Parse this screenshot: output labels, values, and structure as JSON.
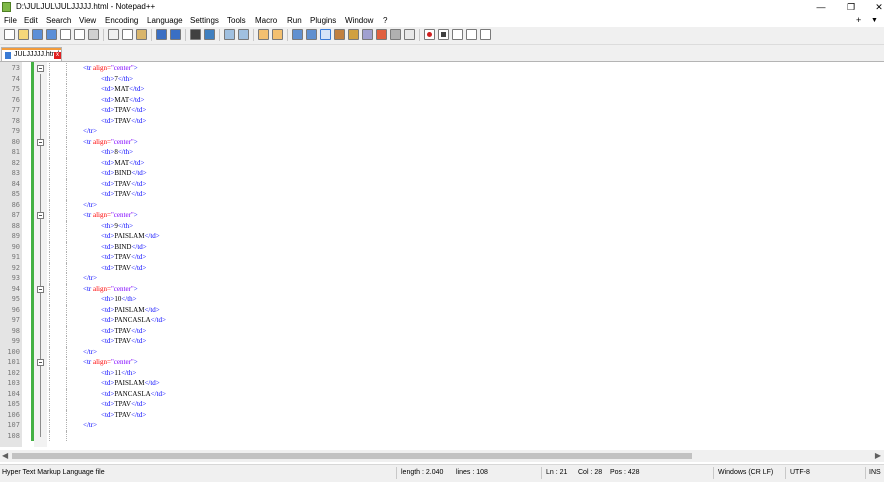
{
  "window": {
    "title": "D:\\JULJUL\\JULJJJJJ.html - Notepad++",
    "minimize_label": "—",
    "maximize_label": "❐",
    "close_label": "✕"
  },
  "menu": {
    "items": [
      "File",
      "Edit",
      "Search",
      "View",
      "Encoding",
      "Language",
      "Settings",
      "Tools",
      "Macro",
      "Run",
      "Plugins",
      "Window",
      "?"
    ],
    "add_label": "+",
    "dropdown_label": "▼"
  },
  "tab": {
    "label": "JULJJJJJ.html",
    "close_label": "x",
    "accent_color": "#f39c3c"
  },
  "editor": {
    "lines": [
      {
        "n": "73",
        "kind": "open"
      },
      {
        "n": "74",
        "kind": "cell",
        "tag": "th",
        "text": "7"
      },
      {
        "n": "75",
        "kind": "cell",
        "tag": "td",
        "text": "MAT"
      },
      {
        "n": "76",
        "kind": "cell",
        "tag": "td",
        "text": "MAT"
      },
      {
        "n": "77",
        "kind": "cell",
        "tag": "td",
        "text": "TPAV"
      },
      {
        "n": "78",
        "kind": "cell",
        "tag": "td",
        "text": "TPAV"
      },
      {
        "n": "79",
        "kind": "close"
      },
      {
        "n": "80",
        "kind": "open"
      },
      {
        "n": "81",
        "kind": "cell",
        "tag": "th",
        "text": "8"
      },
      {
        "n": "82",
        "kind": "cell",
        "tag": "td",
        "text": "MAT"
      },
      {
        "n": "83",
        "kind": "cell",
        "tag": "td",
        "text": "BIND"
      },
      {
        "n": "84",
        "kind": "cell",
        "tag": "td",
        "text": "TPAV"
      },
      {
        "n": "85",
        "kind": "cell",
        "tag": "td",
        "text": "TPAV"
      },
      {
        "n": "86",
        "kind": "close"
      },
      {
        "n": "87",
        "kind": "open"
      },
      {
        "n": "88",
        "kind": "cell",
        "tag": "th",
        "text": "9"
      },
      {
        "n": "89",
        "kind": "cell",
        "tag": "td",
        "text": "PAISLAM"
      },
      {
        "n": "90",
        "kind": "cell",
        "tag": "td",
        "text": "BIND"
      },
      {
        "n": "91",
        "kind": "cell",
        "tag": "td",
        "text": "TPAV"
      },
      {
        "n": "92",
        "kind": "cell",
        "tag": "td",
        "text": "TPAV"
      },
      {
        "n": "93",
        "kind": "close"
      },
      {
        "n": "94",
        "kind": "open"
      },
      {
        "n": "95",
        "kind": "cell",
        "tag": "th",
        "text": "10"
      },
      {
        "n": "96",
        "kind": "cell",
        "tag": "td",
        "text": "PAISLAM"
      },
      {
        "n": "97",
        "kind": "cell",
        "tag": "td",
        "text": "PANCASLA"
      },
      {
        "n": "98",
        "kind": "cell",
        "tag": "td",
        "text": "TPAV"
      },
      {
        "n": "99",
        "kind": "cell",
        "tag": "td",
        "text": "TPAV"
      },
      {
        "n": "100",
        "kind": "close"
      },
      {
        "n": "101",
        "kind": "open"
      },
      {
        "n": "102",
        "kind": "cell",
        "tag": "th",
        "text": "11"
      },
      {
        "n": "103",
        "kind": "cell",
        "tag": "td",
        "text": "PAISLAM"
      },
      {
        "n": "104",
        "kind": "cell",
        "tag": "td",
        "text": "PANCASLA"
      },
      {
        "n": "105",
        "kind": "cell",
        "tag": "td",
        "text": "TPAV"
      },
      {
        "n": "106",
        "kind": "cell",
        "tag": "td",
        "text": "TPAV"
      },
      {
        "n": "107",
        "kind": "close"
      },
      {
        "n": "108",
        "kind": "empty"
      }
    ],
    "tr_open_tag": "<tr",
    "tr_attr": "align=",
    "tr_value": "\"center\"",
    "tr_end": ">",
    "tr_close": "</tr>",
    "colors": {
      "tag": "#0000ff",
      "attr": "#ff0000",
      "value": "#8000ff",
      "text": "#000000",
      "change_bar": "#43b043"
    }
  },
  "status": {
    "file_type": "Hyper Text Markup Language file",
    "length": "length : 2.040",
    "lines": "lines : 108",
    "ln": "Ln : 21",
    "col": "Col : 28",
    "pos": "Pos : 428",
    "eol": "Windows (CR LF)",
    "encoding": "UTF-8",
    "mode": "INS"
  },
  "toolbar": {
    "icons": [
      "new-file-icon",
      "open-file-icon",
      "save-icon",
      "save-all-icon",
      "close-icon",
      "close-all-icon",
      "print-icon",
      "cut-icon",
      "copy-icon",
      "paste-icon",
      "undo-icon",
      "redo-icon",
      "find-icon",
      "replace-icon",
      "zoom-in-icon",
      "zoom-out-icon",
      "sync-vertical-icon",
      "sync-horizontal-icon",
      "word-wrap-icon",
      "show-all-chars-icon",
      "indent-guide-icon",
      "user-language-icon",
      "doc-map-icon",
      "function-list-icon",
      "folder-workspace-icon",
      "monitoring-icon",
      "record-macro-icon",
      "stop-macro-icon",
      "play-macro-icon",
      "run-macro-multiple-icon",
      "save-macro-icon"
    ]
  },
  "scrollbar": {
    "left_arrow": "◀",
    "right_arrow": "▶"
  }
}
